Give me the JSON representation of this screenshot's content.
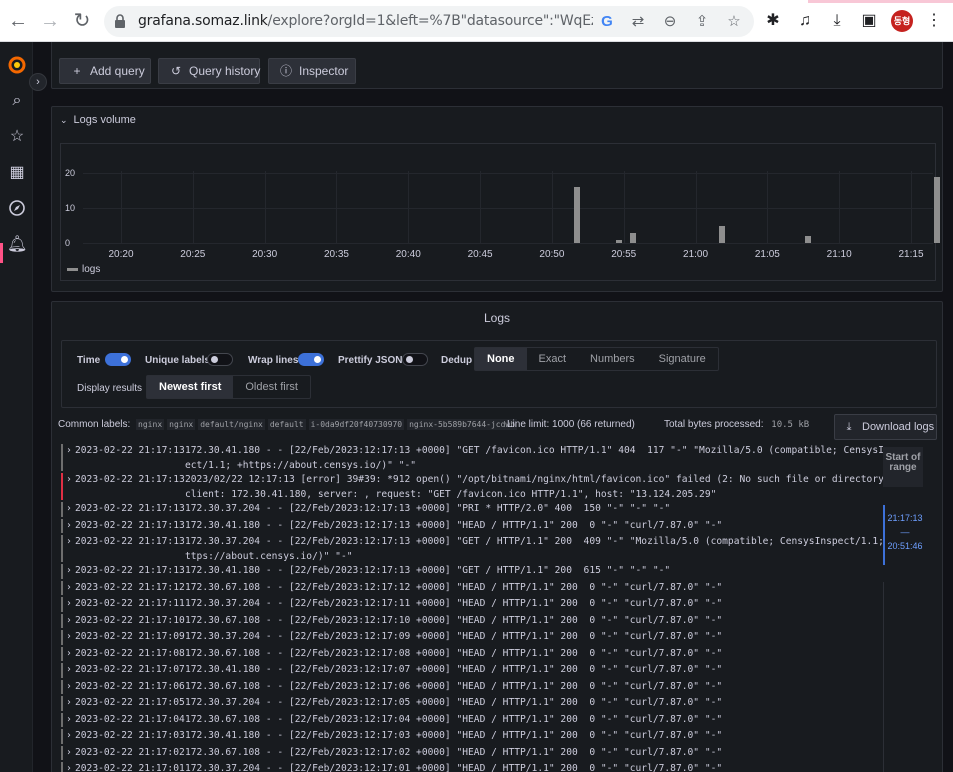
{
  "browser": {
    "url_host": "grafana.somaz.link",
    "url_path": "/explore?orgId=1&left=%7B\"datasource\":\"WqEzDe...",
    "avatar_text": "동형",
    "colors": {
      "chrome_bg": "#ffffff",
      "omnibox_bg": "#f1f3f4",
      "avatar": "#c5221f"
    }
  },
  "toolbar": {
    "add_query": "Add query",
    "query_history": "Query history",
    "inspector": "Inspector"
  },
  "logs_volume": {
    "title": "Logs volume",
    "legend": "logs",
    "chart_data": {
      "type": "bar",
      "y_ticks": [
        "20",
        "10",
        "0"
      ],
      "ylim": [
        0,
        20
      ],
      "x_ticks": [
        "20:20",
        "20:25",
        "20:30",
        "20:35",
        "20:40",
        "20:45",
        "20:50",
        "20:55",
        "21:00",
        "21:05",
        "21:10",
        "21:15"
      ],
      "series": [
        {
          "name": "logs",
          "x": [
            "20:51:46",
            "20:54:40",
            "20:55:40",
            "21:01:50",
            "21:07:50",
            "21:16:50"
          ],
          "values": [
            16,
            1,
            3,
            5,
            2,
            19
          ]
        }
      ],
      "grid": true,
      "legend_position": "bottom-left"
    }
  },
  "logs_panel": {
    "title": "Logs",
    "options": {
      "time": "Time",
      "unique_labels": "Unique labels",
      "wrap_lines": "Wrap lines",
      "prettify_json": "Prettify JSON",
      "dedup": "Dedup",
      "dedup_options": [
        "None",
        "Exact",
        "Numbers",
        "Signature"
      ],
      "dedup_selected": "None",
      "display_results": "Display results",
      "order_options": [
        "Newest first",
        "Oldest first"
      ],
      "order_selected": "Newest first"
    },
    "common_labels_title": "Common labels:",
    "common_labels": [
      "nginx",
      "nginx",
      "default/nginx",
      "default",
      "i-0da9df20f40730970",
      "nginx-5b589b7644-jcdwb"
    ],
    "line_limit": "Line limit: 1000 (66 returned)",
    "bytes_processed": "Total bytes processed:",
    "bytes_value": "10.5 kB",
    "download": "Download logs",
    "range": {
      "start_label": "Start of range",
      "top": "21:17:13",
      "sep": "—",
      "bottom": "20:51:46"
    },
    "rows": [
      {
        "ts": "2023-02-22 21:17:13",
        "msg": "172.30.41.180 - - [22/Feb/2023:12:17:13 +0000] \"GET /favicon.ico HTTP/1.1\" 404  117 \"-\" \"Mozilla/5.0 (compatible; CensysInsp",
        "cont": "ect/1.1; +https://about.censys.io/)\" \"-\"",
        "level": "unknown"
      },
      {
        "ts": "2023-02-22 21:17:13",
        "msg": "2023/02/22 12:17:13 [error] 39#39: *912 open() \"/opt/bitnami/nginx/html/favicon.ico\" failed (2: No such file or directory),",
        "cont": "client: 172.30.41.180, server: , request: \"GET /favicon.ico HTTP/1.1\", host: \"13.124.205.29\"",
        "level": "error"
      },
      {
        "ts": "2023-02-22 21:17:13",
        "msg": "172.30.37.204 - - [22/Feb/2023:12:17:13 +0000] \"PRI * HTTP/2.0\" 400  150 \"-\" \"-\" \"-\"",
        "cont": "",
        "level": "unknown"
      },
      {
        "ts": "2023-02-22 21:17:13",
        "msg": "172.30.41.180 - - [22/Feb/2023:12:17:13 +0000] \"HEAD / HTTP/1.1\" 200  0 \"-\" \"curl/7.87.0\" \"-\"",
        "cont": "",
        "level": "unknown"
      },
      {
        "ts": "2023-02-22 21:17:13",
        "msg": "172.30.37.204 - - [22/Feb/2023:12:17:13 +0000] \"GET / HTTP/1.1\" 200  409 \"-\" \"Mozilla/5.0 (compatible; CensysInspect/1.1; +h",
        "cont": "ttps://about.censys.io/)\" \"-\"",
        "level": "unknown"
      },
      {
        "ts": "2023-02-22 21:17:13",
        "msg": "172.30.41.180 - - [22/Feb/2023:12:17:13 +0000] \"GET / HTTP/1.1\" 200  615 \"-\" \"-\" \"-\"",
        "cont": "",
        "level": "unknown"
      },
      {
        "ts": "2023-02-22 21:17:12",
        "msg": "172.30.67.108 - - [22/Feb/2023:12:17:12 +0000] \"HEAD / HTTP/1.1\" 200  0 \"-\" \"curl/7.87.0\" \"-\"",
        "cont": "",
        "level": "unknown"
      },
      {
        "ts": "2023-02-22 21:17:11",
        "msg": "172.30.37.204 - - [22/Feb/2023:12:17:11 +0000] \"HEAD / HTTP/1.1\" 200  0 \"-\" \"curl/7.87.0\" \"-\"",
        "cont": "",
        "level": "unknown"
      },
      {
        "ts": "2023-02-22 21:17:10",
        "msg": "172.30.67.108 - - [22/Feb/2023:12:17:10 +0000] \"HEAD / HTTP/1.1\" 200  0 \"-\" \"curl/7.87.0\" \"-\"",
        "cont": "",
        "level": "unknown"
      },
      {
        "ts": "2023-02-22 21:17:09",
        "msg": "172.30.37.204 - - [22/Feb/2023:12:17:09 +0000] \"HEAD / HTTP/1.1\" 200  0 \"-\" \"curl/7.87.0\" \"-\"",
        "cont": "",
        "level": "unknown"
      },
      {
        "ts": "2023-02-22 21:17:08",
        "msg": "172.30.67.108 - - [22/Feb/2023:12:17:08 +0000] \"HEAD / HTTP/1.1\" 200  0 \"-\" \"curl/7.87.0\" \"-\"",
        "cont": "",
        "level": "unknown"
      },
      {
        "ts": "2023-02-22 21:17:07",
        "msg": "172.30.41.180 - - [22/Feb/2023:12:17:07 +0000] \"HEAD / HTTP/1.1\" 200  0 \"-\" \"curl/7.87.0\" \"-\"",
        "cont": "",
        "level": "unknown"
      },
      {
        "ts": "2023-02-22 21:17:06",
        "msg": "172.30.67.108 - - [22/Feb/2023:12:17:06 +0000] \"HEAD / HTTP/1.1\" 200  0 \"-\" \"curl/7.87.0\" \"-\"",
        "cont": "",
        "level": "unknown"
      },
      {
        "ts": "2023-02-22 21:17:05",
        "msg": "172.30.37.204 - - [22/Feb/2023:12:17:05 +0000] \"HEAD / HTTP/1.1\" 200  0 \"-\" \"curl/7.87.0\" \"-\"",
        "cont": "",
        "level": "unknown"
      },
      {
        "ts": "2023-02-22 21:17:04",
        "msg": "172.30.67.108 - - [22/Feb/2023:12:17:04 +0000] \"HEAD / HTTP/1.1\" 200  0 \"-\" \"curl/7.87.0\" \"-\"",
        "cont": "",
        "level": "unknown"
      },
      {
        "ts": "2023-02-22 21:17:03",
        "msg": "172.30.41.180 - - [22/Feb/2023:12:17:03 +0000] \"HEAD / HTTP/1.1\" 200  0 \"-\" \"curl/7.87.0\" \"-\"",
        "cont": "",
        "level": "unknown"
      },
      {
        "ts": "2023-02-22 21:17:02",
        "msg": "172.30.67.108 - - [22/Feb/2023:12:17:02 +0000] \"HEAD / HTTP/1.1\" 200  0 \"-\" \"curl/7.87.0\" \"-\"",
        "cont": "",
        "level": "unknown"
      },
      {
        "ts": "2023-02-22 21:17:01",
        "msg": "172.30.37.204 - - [22/Feb/2023:12:17:01 +0000] \"HEAD / HTTP/1.1\" 200  0 \"-\" \"curl/7.87.0\" \"-\"",
        "cont": "",
        "level": "unknown"
      }
    ]
  },
  "sidemenu": {
    "items": [
      "grafana-logo-icon",
      "search-icon",
      "star-icon",
      "dashboards-icon",
      "explore-icon",
      "alerting-icon"
    ],
    "active": "explore-icon",
    "accent": "#ff5286"
  }
}
